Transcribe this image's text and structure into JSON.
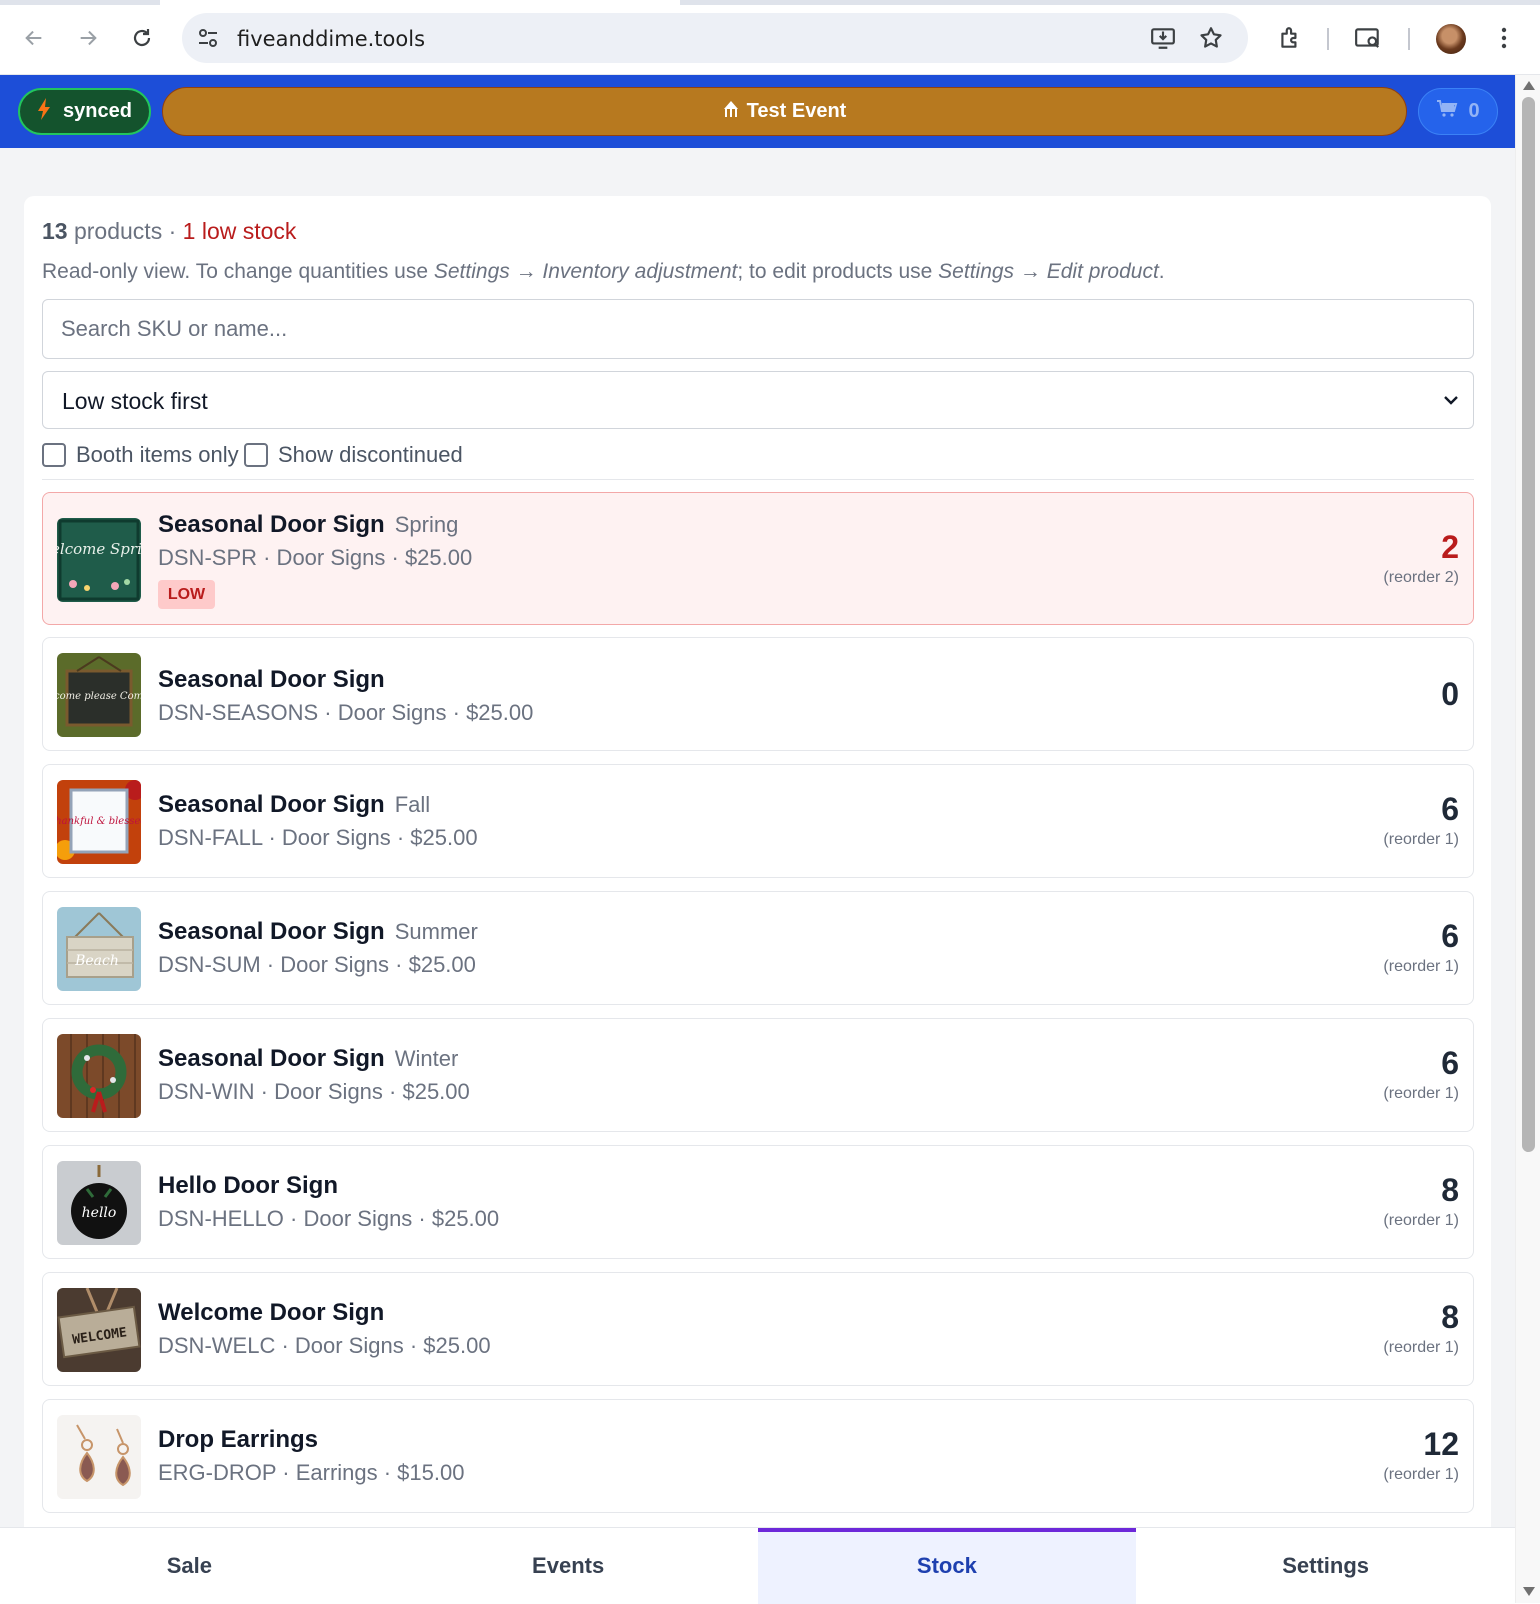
{
  "browser": {
    "url": "fiveanddime.tools"
  },
  "header": {
    "sync_label": "synced",
    "event_label": "Test Event",
    "cart_count": "0"
  },
  "stock": {
    "summary_count": "13",
    "summary_products": "products",
    "summary_sep": "·",
    "summary_low": "1 low stock",
    "note_prefix": "Read-only view. To change quantities use ",
    "note_path1": "Settings → Inventory adjustment",
    "note_mid": "; to edit products use ",
    "note_path2": "Settings → Edit product",
    "note_suffix": ".",
    "search_placeholder": "Search SKU or name...",
    "sort_value": "Low stock first",
    "filter_booth": "Booth items only",
    "filter_discontinued": "Show discontinued"
  },
  "items": [
    {
      "name": "Seasonal Door Sign",
      "variant": "Spring",
      "meta": "DSN-SPR · Door Signs · $25.00",
      "badge": "LOW",
      "qty": "2",
      "reorder": "(reorder 2)"
    },
    {
      "name": "Seasonal Door Sign",
      "variant": "",
      "meta": "DSN-SEASONS · Door Signs · $25.00",
      "qty": "0",
      "reorder": ""
    },
    {
      "name": "Seasonal Door Sign",
      "variant": "Fall",
      "meta": "DSN-FALL · Door Signs · $25.00",
      "qty": "6",
      "reorder": "(reorder 1)"
    },
    {
      "name": "Seasonal Door Sign",
      "variant": "Summer",
      "meta": "DSN-SUM · Door Signs · $25.00",
      "qty": "6",
      "reorder": "(reorder 1)"
    },
    {
      "name": "Seasonal Door Sign",
      "variant": "Winter",
      "meta": "DSN-WIN · Door Signs · $25.00",
      "qty": "6",
      "reorder": "(reorder 1)"
    },
    {
      "name": "Hello Door Sign",
      "variant": "",
      "meta": "DSN-HELLO · Door Signs · $25.00",
      "qty": "8",
      "reorder": "(reorder 1)"
    },
    {
      "name": "Welcome Door Sign",
      "variant": "",
      "meta": "DSN-WELC · Door Signs · $25.00",
      "qty": "8",
      "reorder": "(reorder 1)"
    },
    {
      "name": "Drop Earrings",
      "variant": "",
      "meta": "ERG-DROP · Earrings · $15.00",
      "qty": "12",
      "reorder": "(reorder 1)"
    }
  ],
  "thumb_text": {
    "spring": "Welcome Spring",
    "seasons": "Welcome please Come In",
    "fall": "thankful & blessed",
    "summer": "Beach",
    "hello": "hello",
    "welcome": "WELCOME"
  },
  "nav": {
    "sale": "Sale",
    "events": "Events",
    "stock": "Stock",
    "settings": "Settings"
  },
  "colors": {
    "header_bg": "#1d4ed8",
    "event_bg": "#b7791f",
    "sync_bg": "#14532d",
    "low_red": "#b91c1c",
    "active_tab_accent": "#6d28d9"
  }
}
